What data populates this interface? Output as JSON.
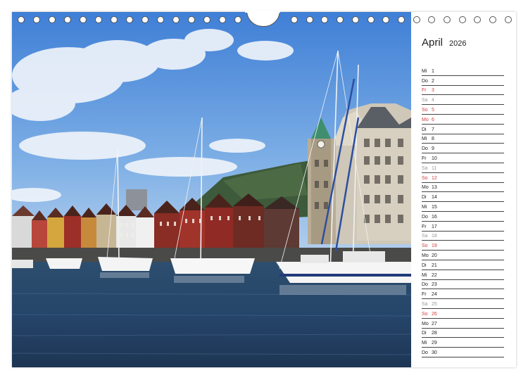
{
  "calendar": {
    "month": "April",
    "year": "2026",
    "days": [
      {
        "wd": "Mi",
        "d": "1",
        "kind": "normal"
      },
      {
        "wd": "Do",
        "d": "2",
        "kind": "normal"
      },
      {
        "wd": "Fr",
        "d": "3",
        "kind": "holiday"
      },
      {
        "wd": "Sa",
        "d": "4",
        "kind": "sat"
      },
      {
        "wd": "So",
        "d": "5",
        "kind": "holiday"
      },
      {
        "wd": "Mo",
        "d": "6",
        "kind": "holiday"
      },
      {
        "wd": "Di",
        "d": "7",
        "kind": "normal"
      },
      {
        "wd": "Mi",
        "d": "8",
        "kind": "normal"
      },
      {
        "wd": "Do",
        "d": "9",
        "kind": "normal"
      },
      {
        "wd": "Fr",
        "d": "10",
        "kind": "normal"
      },
      {
        "wd": "Sa",
        "d": "11",
        "kind": "sat"
      },
      {
        "wd": "So",
        "d": "12",
        "kind": "holiday"
      },
      {
        "wd": "Mo",
        "d": "13",
        "kind": "normal"
      },
      {
        "wd": "Di",
        "d": "14",
        "kind": "normal"
      },
      {
        "wd": "Mi",
        "d": "15",
        "kind": "normal"
      },
      {
        "wd": "Do",
        "d": "16",
        "kind": "normal"
      },
      {
        "wd": "Fr",
        "d": "17",
        "kind": "normal"
      },
      {
        "wd": "Sa",
        "d": "18",
        "kind": "sat"
      },
      {
        "wd": "So",
        "d": "19",
        "kind": "holiday"
      },
      {
        "wd": "Mo",
        "d": "20",
        "kind": "normal"
      },
      {
        "wd": "Di",
        "d": "21",
        "kind": "normal"
      },
      {
        "wd": "Mi",
        "d": "22",
        "kind": "normal"
      },
      {
        "wd": "Do",
        "d": "23",
        "kind": "normal"
      },
      {
        "wd": "Fr",
        "d": "24",
        "kind": "normal"
      },
      {
        "wd": "Sa",
        "d": "25",
        "kind": "sat"
      },
      {
        "wd": "So",
        "d": "26",
        "kind": "holiday"
      },
      {
        "wd": "Mo",
        "d": "27",
        "kind": "normal"
      },
      {
        "wd": "Di",
        "d": "28",
        "kind": "normal"
      },
      {
        "wd": "Mi",
        "d": "29",
        "kind": "normal"
      },
      {
        "wd": "Do",
        "d": "30",
        "kind": "normal"
      }
    ]
  },
  "colors": {
    "holiday": "#d23c3c",
    "saturday": "#999999",
    "text": "#222222"
  },
  "binding": {
    "hole_count": 31
  }
}
